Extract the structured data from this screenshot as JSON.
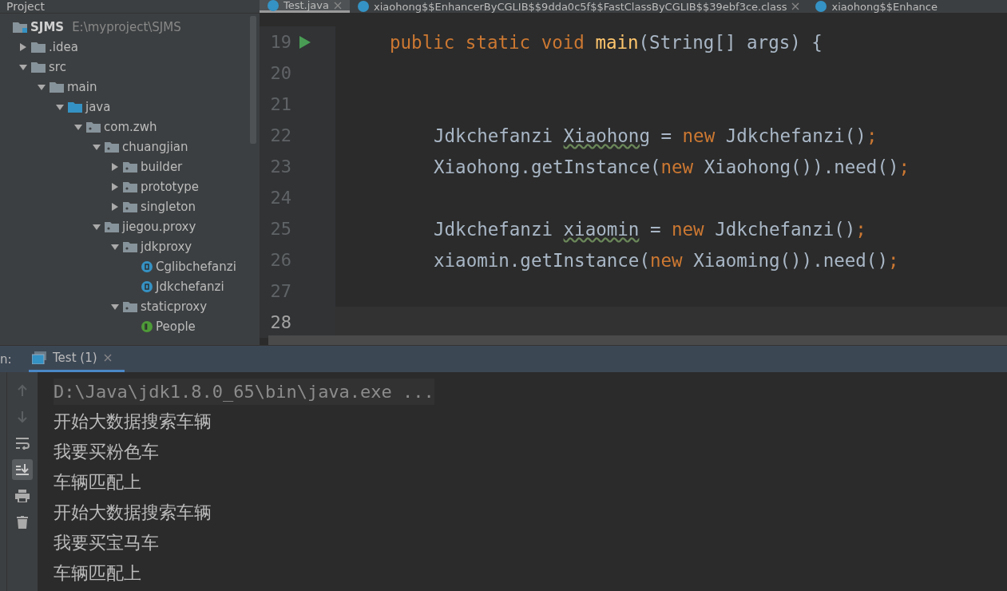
{
  "project_panel": {
    "title": "Project",
    "tree": [
      {
        "label": "SJMS",
        "path": "E:\\myproject\\SJMS",
        "kind": "module",
        "children": [
          {
            "label": ".idea",
            "kind": "folder",
            "expanded": false
          },
          {
            "label": "src",
            "kind": "folder",
            "expanded": true,
            "children": [
              {
                "label": "main",
                "kind": "folder",
                "expanded": true,
                "children": [
                  {
                    "label": "java",
                    "kind": "source",
                    "expanded": true,
                    "children": [
                      {
                        "label": "com.zwh",
                        "kind": "package",
                        "expanded": true,
                        "children": [
                          {
                            "label": "chuangjian",
                            "kind": "package",
                            "expanded": true,
                            "children": [
                              {
                                "label": "builder",
                                "kind": "package",
                                "expanded": false
                              },
                              {
                                "label": "prototype",
                                "kind": "package",
                                "expanded": false
                              },
                              {
                                "label": "singleton",
                                "kind": "package",
                                "expanded": false
                              }
                            ]
                          },
                          {
                            "label": "jiegou.proxy",
                            "kind": "package",
                            "expanded": true,
                            "children": [
                              {
                                "label": "jdkproxy",
                                "kind": "package",
                                "expanded": true,
                                "children": [
                                  {
                                    "label": "Cglibchefanzi",
                                    "kind": "class"
                                  },
                                  {
                                    "label": "Jdkchefanzi",
                                    "kind": "class"
                                  }
                                ]
                              },
                              {
                                "label": "staticproxy",
                                "kind": "package",
                                "expanded": true,
                                "children": [
                                  {
                                    "label": "People",
                                    "kind": "interface"
                                  }
                                ]
                              }
                            ]
                          }
                        ]
                      }
                    ]
                  }
                ]
              }
            ]
          }
        ]
      }
    ]
  },
  "editor": {
    "tabs": [
      {
        "label": "Test.java",
        "selected": true,
        "closable": true
      },
      {
        "label": "xiaohong$$EnhancerByCGLIB$$9dda0c5f$$FastClassByCGLIB$$39ebf3ce.class",
        "selected": false,
        "closable": true
      },
      {
        "label": "xiaohong$$Enhance",
        "selected": false,
        "closable": false
      }
    ],
    "lines": [
      {
        "number": "19",
        "current": false,
        "run": true,
        "kind": "method",
        "tokens": [
          {
            "t": "public static void ",
            "kind": "keyword"
          },
          {
            "t": "main",
            "kind": "method"
          },
          {
            "t": "(String[] args) {",
            "kind": "plain"
          }
        ]
      },
      {
        "number": "20",
        "current": false,
        "run": false,
        "kind": "blank"
      },
      {
        "number": "21",
        "current": false,
        "run": false,
        "kind": "blank"
      },
      {
        "number": "22",
        "current": false,
        "run": false,
        "kind": "statement",
        "tokens": [
          {
            "t": "Jdkchefanzi ",
            "kind": "plain"
          },
          {
            "t": "Xiaohong",
            "kind": "warning"
          },
          {
            "t": " = ",
            "kind": "plain"
          },
          {
            "t": "new ",
            "kind": "keyword"
          },
          {
            "t": "Jdkchefanzi()",
            "kind": "plain"
          },
          {
            "t": ";",
            "kind": "keyword"
          }
        ]
      },
      {
        "number": "23",
        "current": false,
        "run": false,
        "kind": "statement",
        "tokens": [
          {
            "t": "Xiaohong.getInstance(",
            "kind": "plain"
          },
          {
            "t": "new ",
            "kind": "keyword"
          },
          {
            "t": "Xiaohong()).need()",
            "kind": "plain"
          },
          {
            "t": ";",
            "kind": "keyword"
          }
        ]
      },
      {
        "number": "24",
        "current": false,
        "run": false,
        "kind": "blank"
      },
      {
        "number": "25",
        "current": false,
        "run": false,
        "kind": "statement",
        "tokens": [
          {
            "t": "Jdkchefanzi ",
            "kind": "plain"
          },
          {
            "t": "xiaomin",
            "kind": "warning"
          },
          {
            "t": " = ",
            "kind": "plain"
          },
          {
            "t": "new ",
            "kind": "keyword"
          },
          {
            "t": "Jdkchefanzi()",
            "kind": "plain"
          },
          {
            "t": ";",
            "kind": "keyword"
          }
        ]
      },
      {
        "number": "26",
        "current": false,
        "run": false,
        "kind": "statement",
        "tokens": [
          {
            "t": "xiaomin.getInstance(",
            "kind": "plain"
          },
          {
            "t": "new ",
            "kind": "keyword"
          },
          {
            "t": "Xiaoming()).need()",
            "kind": "plain"
          },
          {
            "t": ";",
            "kind": "keyword"
          }
        ]
      },
      {
        "number": "27",
        "current": false,
        "run": false,
        "kind": "blank"
      },
      {
        "number": "28",
        "current": true,
        "run": false,
        "kind": "blank"
      }
    ]
  },
  "run_panel": {
    "label": "n:",
    "tabs": [
      {
        "label": "Test (1)",
        "selected": true
      }
    ],
    "console": [
      {
        "text": "D:\\Java\\jdk1.8.0_65\\bin\\java.exe ...",
        "kind": "command"
      },
      {
        "text": "开始大数据搜索车辆",
        "kind": "output"
      },
      {
        "text": "我要买粉色车",
        "kind": "output"
      },
      {
        "text": "车辆匹配上",
        "kind": "output"
      },
      {
        "text": "开始大数据搜索车辆",
        "kind": "output"
      },
      {
        "text": "我要买宝马车",
        "kind": "output"
      },
      {
        "text": "车辆匹配上",
        "kind": "output"
      }
    ]
  }
}
